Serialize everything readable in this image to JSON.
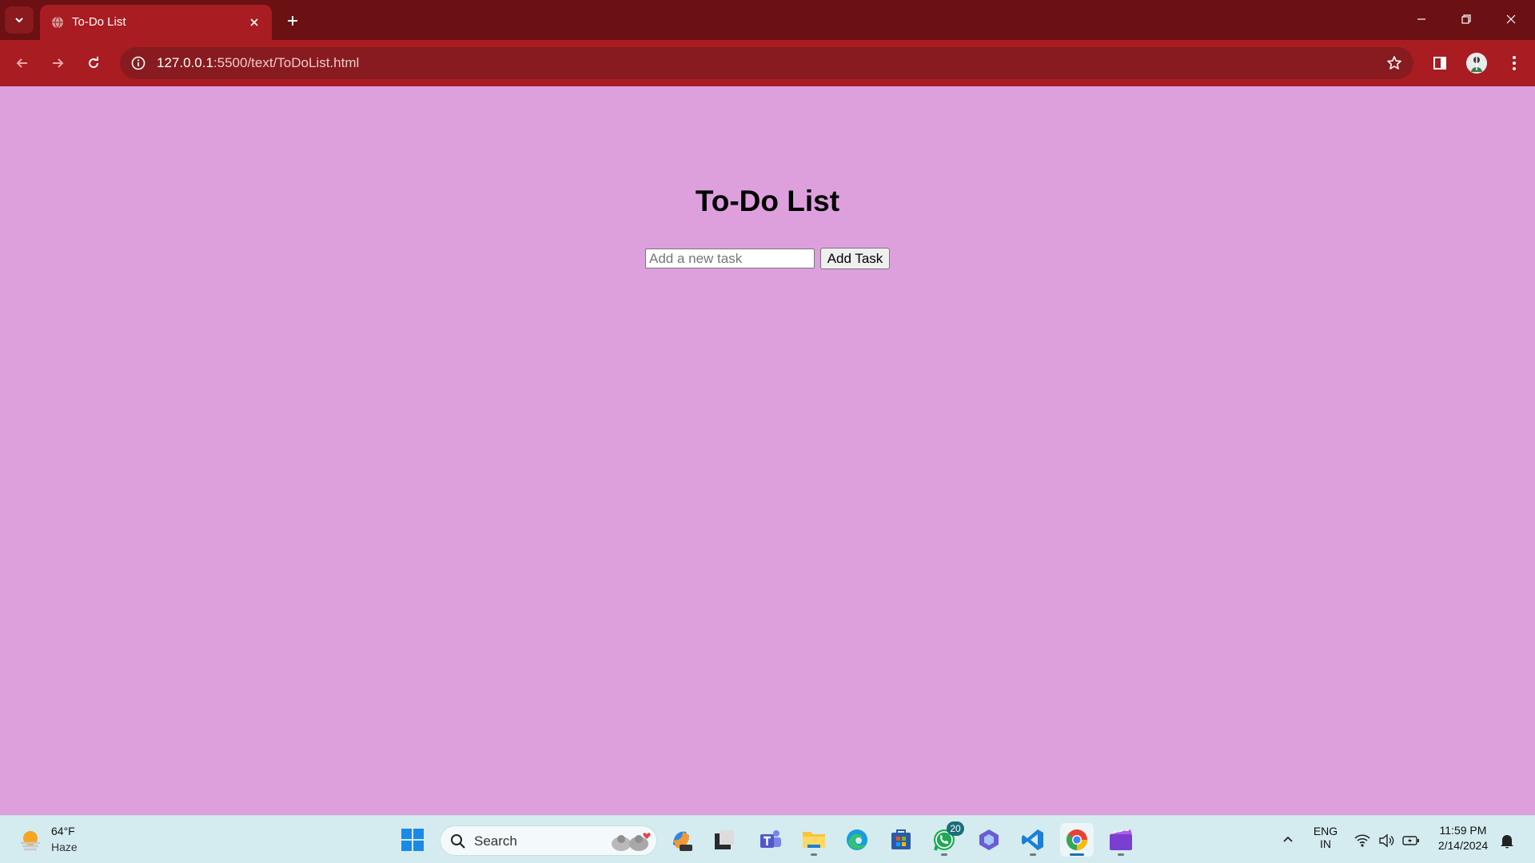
{
  "browser": {
    "tab_title": "To-Do List",
    "url_host": "127.0.0.1",
    "url_path": ":5500/text/ToDoList.html"
  },
  "page": {
    "title": "To-Do List",
    "input_placeholder": "Add a new task",
    "add_button_label": "Add Task",
    "background_color": "#dda0dd"
  },
  "taskbar": {
    "weather_temp": "64°F",
    "weather_condition": "Haze",
    "search_label": "Search",
    "whatsapp_badge": "20",
    "language_top": "ENG",
    "language_bottom": "IN",
    "time": "11:59 PM",
    "date": "2/14/2024",
    "apps": [
      "start-icon",
      "search-icon",
      "copilot-icon",
      "task-view-icon",
      "teams-icon",
      "file-explorer-icon",
      "edge-icon",
      "store-icon",
      "whatsapp-icon",
      "app-icon",
      "vscode-icon",
      "chrome-icon",
      "clipchamp-icon"
    ]
  },
  "colors": {
    "tab_strip": "#6b1013",
    "toolbar": "#a81c22",
    "omnibox": "#881b1f",
    "taskbar": "#d4ecef"
  }
}
